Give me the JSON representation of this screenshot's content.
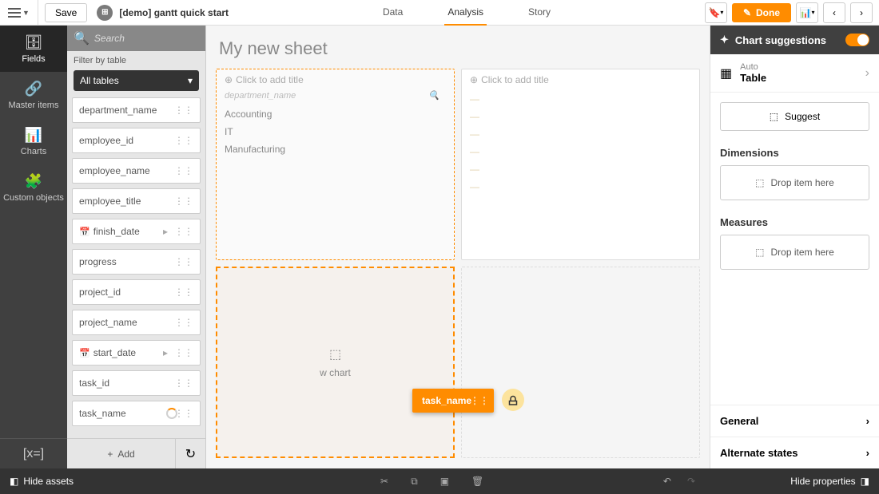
{
  "topbar": {
    "save_label": "Save",
    "app_title": "[demo] gantt quick start",
    "tabs": {
      "data": "Data",
      "analysis": "Analysis",
      "story": "Story"
    },
    "done_label": "Done"
  },
  "left_nav": {
    "fields": "Fields",
    "master_items": "Master items",
    "charts": "Charts",
    "custom_objects": "Custom objects"
  },
  "fields_panel": {
    "search_placeholder": "Search",
    "filter_label": "Filter by table",
    "table_select": "All tables",
    "fields": [
      "department_name",
      "employee_id",
      "employee_name",
      "employee_title",
      "finish_date",
      "progress",
      "project_id",
      "project_name",
      "start_date",
      "task_id",
      "task_name"
    ],
    "add_label": "Add"
  },
  "canvas": {
    "sheet_title": "My new sheet",
    "add_title_placeholder": "Click to add title",
    "chart1": {
      "header": "department_name",
      "rows": [
        "Accounting",
        "IT",
        "Manufacturing"
      ]
    },
    "chart2": {
      "rows_faded": [
        "",
        "",
        "",
        "",
        "",
        ""
      ]
    },
    "drop_label": "Drag task_name to a new chart",
    "new_chart_label": "w chart",
    "drag_field": "task_name"
  },
  "right_panel": {
    "suggestions_title": "Chart suggestions",
    "auto_label": "Auto",
    "auto_value": "Table",
    "suggest_label": "Suggest",
    "dimensions_title": "Dimensions",
    "measures_title": "Measures",
    "drop_item_label": "Drop item here",
    "general": "General",
    "alternate_states": "Alternate states"
  },
  "footer": {
    "hide_assets": "Hide assets",
    "hide_properties": "Hide properties"
  }
}
